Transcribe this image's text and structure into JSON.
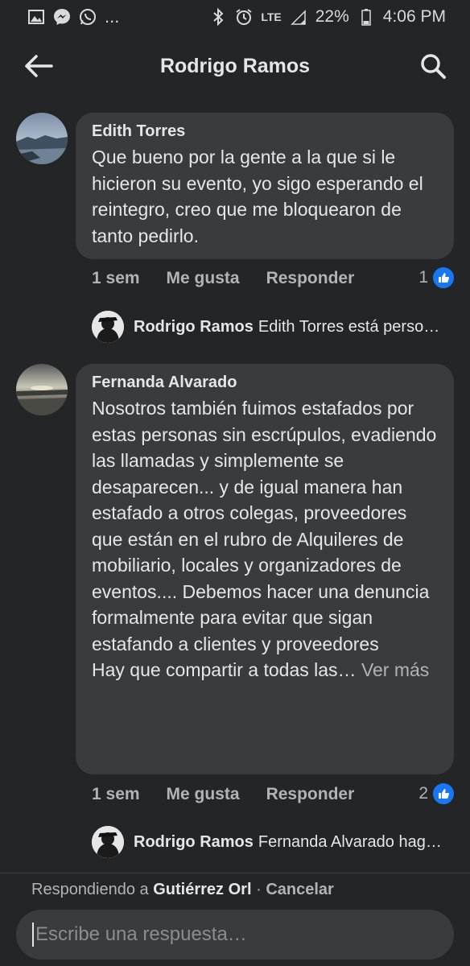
{
  "status_bar": {
    "battery": "22%",
    "time": "4:06 PM",
    "more": "...",
    "network": "LTE"
  },
  "header": {
    "title": "Rodrigo Ramos"
  },
  "comments": [
    {
      "author": "Edith Torres",
      "text": "Que bueno por la gente a la que si le hicieron su evento, yo sigo esperando el reintegro, creo que me bloquearon de tanto pedirlo.",
      "time": "1 sem",
      "like_label": "Me gusta",
      "reply_label": "Responder",
      "likes": "1",
      "reply": {
        "name": "Rodrigo Ramos",
        "text": "Edith Torres está perso…"
      }
    },
    {
      "author": "Fernanda Alvarado",
      "text": "Nosotros también fuimos estafados por estas personas sin escrúpulos, evadiendo las llamadas y simplemente se desaparecen... y de igual manera han estafado a otros colegas, proveedores que están en el rubro de Alquileres de mobiliario, locales y organizadores de eventos.... Debemos hacer una denuncia formalmente para evitar que sigan estafando a clientes y proveedores",
      "text2": "Hay que compartir a todas las…",
      "see_more": "Ver más",
      "time": "1 sem",
      "like_label": "Me gusta",
      "reply_label": "Responder",
      "likes": "2",
      "reply": {
        "name": "Rodrigo Ramos",
        "text": "Fernanda Alvarado hag…"
      }
    }
  ],
  "reply_bar": {
    "prefix": "Respondiendo a",
    "target": "Gutiérrez Orl",
    "separator": "·",
    "cancel": "Cancelar",
    "placeholder": "Escribe una respuesta…"
  }
}
